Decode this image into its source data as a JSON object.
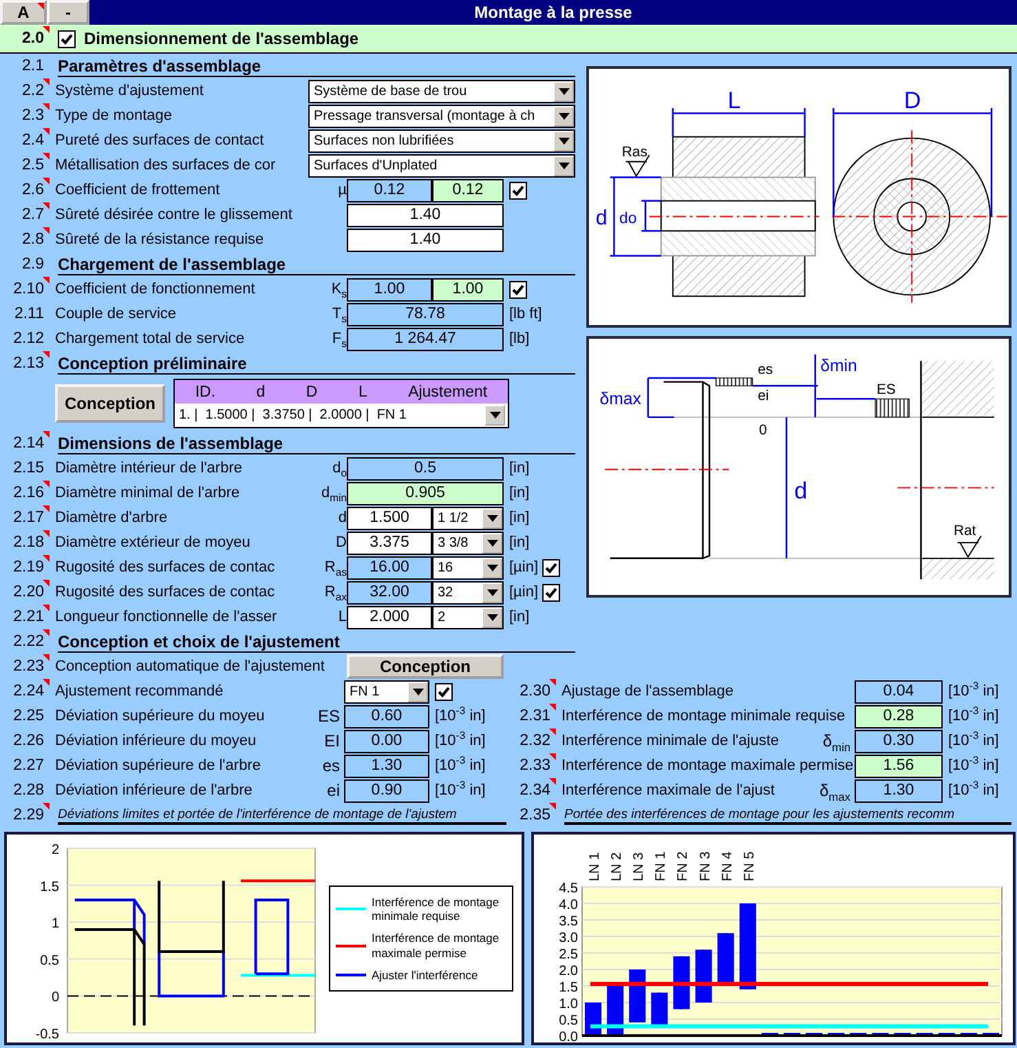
{
  "header": {
    "column_button": "A",
    "column_note": true,
    "collapse_button": "-",
    "title": "Montage à la presse"
  },
  "section": {
    "number": "2.0",
    "checked": true,
    "title": "Dimensionnement de l'assemblage",
    "note": true
  },
  "rows": [
    {
      "kind": "heading",
      "number": "2.1",
      "text": "Paramètres d'assemblage",
      "note": false
    },
    {
      "kind": "select",
      "number": "2.2",
      "label": "Système d'ajustement",
      "value": "Système de base de trou",
      "note": true
    },
    {
      "kind": "select",
      "number": "2.3",
      "label": "Type de montage",
      "value": "Pressage transversal (montage à ch",
      "note": true
    },
    {
      "kind": "select",
      "number": "2.4",
      "label": "Pureté des surfaces de contact",
      "value": "Surfaces non lubrifiées",
      "note": true
    },
    {
      "kind": "select",
      "number": "2.5",
      "label": "Métallisation des surfaces de cor",
      "value": "Surfaces d'Unplated",
      "note": true
    },
    {
      "kind": "field",
      "number": "2.6",
      "label": "Coefficient de frottement",
      "symbol": "µ",
      "cells": [
        {
          "value": "0.12",
          "color": "#99ccff"
        },
        {
          "value": "0.12",
          "color": "#ccffcc"
        }
      ],
      "checked": true,
      "note": true
    },
    {
      "kind": "field",
      "number": "2.7",
      "label": "Sûreté désirée contre le glissement",
      "cells": [
        {
          "value": "1.40",
          "color": "#ffffff"
        }
      ],
      "note": true
    },
    {
      "kind": "field",
      "number": "2.8",
      "label": "Sûreté de la résistance requise",
      "cells": [
        {
          "value": "1.40",
          "color": "#ffffff"
        }
      ],
      "note": true
    },
    {
      "kind": "heading",
      "number": "2.9",
      "text": "Chargement de l'assemblage",
      "note": false
    },
    {
      "kind": "field",
      "number": "2.10",
      "label": "Coefficient de fonctionnement",
      "symbol": "K$_{s}$",
      "cells": [
        {
          "value": "1.00",
          "color": "#99ccff"
        },
        {
          "value": "1.00",
          "color": "#ccffcc"
        }
      ],
      "checked": true,
      "note": true
    },
    {
      "kind": "field",
      "number": "2.11",
      "label": "Couple de service",
      "symbol": "T$_{s}$",
      "cells": [
        {
          "value": "78.78",
          "color": "#99ccff"
        }
      ],
      "unit": "[lb ft]",
      "note": false
    },
    {
      "kind": "field",
      "number": "2.12",
      "label": "Chargement total de service",
      "symbol": "F$_{s}$",
      "cells": [
        {
          "value": "1 264.47",
          "color": "#99ccff"
        }
      ],
      "unit": "[lb]",
      "note": false
    },
    {
      "kind": "heading",
      "number": "2.13",
      "text": "Conception préliminaire",
      "note": true
    },
    {
      "kind": "design",
      "button": "Conception",
      "columns": [
        "ID.",
        "d",
        "D",
        "L",
        "Ajustement"
      ],
      "value": "1. |  1.5000 |  3.3750 |  2.0000 |  FN 1"
    },
    {
      "kind": "heading",
      "number": "2.14",
      "text": "Dimensions de l'assemblage",
      "note": true
    },
    {
      "kind": "field",
      "number": "2.15",
      "label": "Diamètre intérieur de l'arbre",
      "symbol": "d$_{o}$",
      "cells": [
        {
          "value": "0.5",
          "color": "#99ccff"
        }
      ],
      "unit": "[in]",
      "note": false
    },
    {
      "kind": "field",
      "number": "2.16",
      "label": "Diamètre minimal de l'arbre",
      "symbol": "d$_{min}$",
      "cells": [
        {
          "value": "0.905",
          "color": "#ccffcc"
        }
      ],
      "unit": "[in]",
      "note": true
    },
    {
      "kind": "field",
      "number": "2.17",
      "label": "Diamètre d'arbre",
      "symbol": "d",
      "cells": [
        {
          "value": "1.500",
          "color": "#ffffff"
        }
      ],
      "option": "1 1/2",
      "unit": "[in]",
      "note": true
    },
    {
      "kind": "field",
      "number": "2.18",
      "label": "Diamètre extérieur de moyeu",
      "symbol": "D",
      "cells": [
        {
          "value": "3.375",
          "color": "#ffffff"
        }
      ],
      "option": "3 3/8",
      "unit": "[in]",
      "note": true
    },
    {
      "kind": "field",
      "number": "2.19",
      "label": "Rugosité des surfaces de contac",
      "symbol": "R$_{as}$",
      "cells": [
        {
          "value": "16.00",
          "color": "#99ccff"
        }
      ],
      "option": "16",
      "unit": "[µin]",
      "checked": true,
      "note": true
    },
    {
      "kind": "field",
      "number": "2.20",
      "label": "Rugosité des surfaces de contac",
      "symbol": "R$_{ax}$",
      "cells": [
        {
          "value": "32.00",
          "color": "#99ccff"
        }
      ],
      "option": "32",
      "unit": "[µin]",
      "checked": true,
      "note": true
    },
    {
      "kind": "field",
      "number": "2.21",
      "label": "Longueur fonctionnelle de l'asser",
      "symbol": "L",
      "cells": [
        {
          "value": "2.000",
          "color": "#ffffff"
        }
      ],
      "option": "2",
      "unit": "[in]",
      "note": true
    },
    {
      "kind": "heading",
      "number": "2.22",
      "text": "Conception et choix de l'ajustement",
      "note": true
    },
    {
      "kind": "button",
      "number": "2.23",
      "label": "Conception automatique de l'ajustement",
      "button": "Conception",
      "note": true
    }
  ],
  "fit_left": [
    {
      "kind": "choice",
      "number": "2.24",
      "label": "Ajustement recommandé",
      "value": "FN 1",
      "checked": true,
      "note": true
    },
    {
      "kind": "field",
      "number": "2.25",
      "label": "Déviation supérieure du moyeu",
      "symbol": "ES",
      "cells": [
        {
          "value": "0.60",
          "color": "#99ccff"
        }
      ],
      "unit": "[10$^{-3}$ in]",
      "note": false
    },
    {
      "kind": "field",
      "number": "2.26",
      "label": "Déviation inférieure du moyeu",
      "symbol": "EI",
      "cells": [
        {
          "value": "0.00",
          "color": "#99ccff"
        }
      ],
      "unit": "[10$^{-3}$ in]",
      "note": false
    },
    {
      "kind": "field",
      "number": "2.27",
      "label": "Déviation supérieure de l'arbre",
      "symbol": "es",
      "cells": [
        {
          "value": "1.30",
          "color": "#99ccff"
        }
      ],
      "unit": "[10$^{-3}$ in]",
      "note": false
    },
    {
      "kind": "field",
      "number": "2.28",
      "label": "Déviation inférieure de l'arbre",
      "symbol": "ei",
      "cells": [
        {
          "value": "0.90",
          "color": "#99ccff"
        }
      ],
      "unit": "[10$^{-3}$ in]",
      "note": false
    }
  ],
  "fit_left_caption": {
    "number": "2.29",
    "text": "Déviations limites et portée de l'interférence de montage de l'ajustem",
    "note": true
  },
  "fit_right": [
    {
      "kind": "field",
      "number": "2.30",
      "label": "Ajustage de l'assemblage",
      "cells": [
        {
          "value": "0.04",
          "color": "#99ccff"
        }
      ],
      "unit": "[10$^{-3}$ in]",
      "note": true
    },
    {
      "kind": "field",
      "number": "2.31",
      "label": "Interférence de montage minimale requise",
      "cells": [
        {
          "value": "0.28",
          "color": "#ccffcc"
        }
      ],
      "unit": "[10$^{-3}$ in]",
      "note": true
    },
    {
      "kind": "field",
      "number": "2.32",
      "label": "Interférence minimale de l'ajuste",
      "symbol": "δ$_{min}$",
      "cells": [
        {
          "value": "0.30",
          "color": "#99ccff"
        }
      ],
      "unit": "[10$^{-3}$ in]",
      "note": true
    },
    {
      "kind": "field",
      "number": "2.33",
      "label": "Interférence de montage maximale permise",
      "cells": [
        {
          "value": "1.56",
          "color": "#ccffcc"
        }
      ],
      "unit": "[10$^{-3}$ in]",
      "note": true
    },
    {
      "kind": "field",
      "number": "2.34",
      "label": "Interférence maximale de l'ajust",
      "symbol": "δ$_{max}$",
      "cells": [
        {
          "value": "1.30",
          "color": "#99ccff"
        }
      ],
      "unit": "[10$^{-3}$ in]",
      "note": true
    }
  ],
  "fit_right_caption": {
    "number": "2.35",
    "text": "Portée des interférences de montage pour les ajustements recomm",
    "note": true
  },
  "drawings": {
    "assembly_labels": [
      "L",
      "D",
      "Ras",
      "d",
      "do"
    ],
    "tolerance_labels": [
      "δmax",
      "es",
      "ei",
      "δmin",
      "ES",
      "0",
      "d",
      "Rat"
    ]
  },
  "deviation_chart": {
    "yticks": [
      "2",
      "1.5",
      "1",
      "0.5",
      "0",
      "-0.5"
    ],
    "legend": [
      {
        "label": "Interférence de montage minimale requise",
        "color": "#00ffff"
      },
      {
        "label": "Interférence de montage maximale permise",
        "color": "#ff0000"
      },
      {
        "label": "Ajuster l'interférence",
        "color": "#0000ff"
      }
    ]
  },
  "fit_range_chart": {
    "chart_data": {
      "type": "candlestick",
      "grid": true,
      "categories": [
        "LN 1",
        "LN 2",
        "LN 3",
        "FN 1",
        "FN 2",
        "FN 3",
        "FN 4",
        "FN 5"
      ],
      "ylim": [
        0,
        4.5
      ],
      "yticks": [
        {
          "value": 0,
          "label": "0.0"
        },
        {
          "value": 0.5,
          "label": "0.5"
        },
        {
          "value": 1,
          "label": "1.0"
        },
        {
          "value": 1.5,
          "label": "1.5"
        },
        {
          "value": 2,
          "label": "2.0"
        },
        {
          "value": 2.5,
          "label": "2.5"
        },
        {
          "value": 3,
          "label": "3.0"
        },
        {
          "value": 3.5,
          "label": "3.5"
        },
        {
          "value": 4,
          "label": "4.0"
        },
        {
          "value": 4.5,
          "label": "4.5"
        }
      ],
      "ohlc": [
        [
          0,
          1.0,
          0,
          1.0
        ],
        [
          0,
          1.55,
          0,
          1.55
        ],
        [
          0.4,
          2.0,
          0.4,
          2.0
        ],
        [
          0.3,
          1.3,
          0.3,
          1.3
        ],
        [
          0.8,
          2.4,
          0.8,
          2.4
        ],
        [
          1.0,
          2.6,
          1.0,
          2.6
        ],
        [
          1.6,
          3.1,
          1.6,
          3.1
        ],
        [
          1.4,
          4.0,
          1.4,
          4.0
        ]
      ],
      "ref_lines": [
        {
          "axis": "y",
          "value": 1.56,
          "color": "#ff0000"
        },
        {
          "axis": "y",
          "value": 0.28,
          "color": "#00ffff"
        }
      ]
    }
  }
}
